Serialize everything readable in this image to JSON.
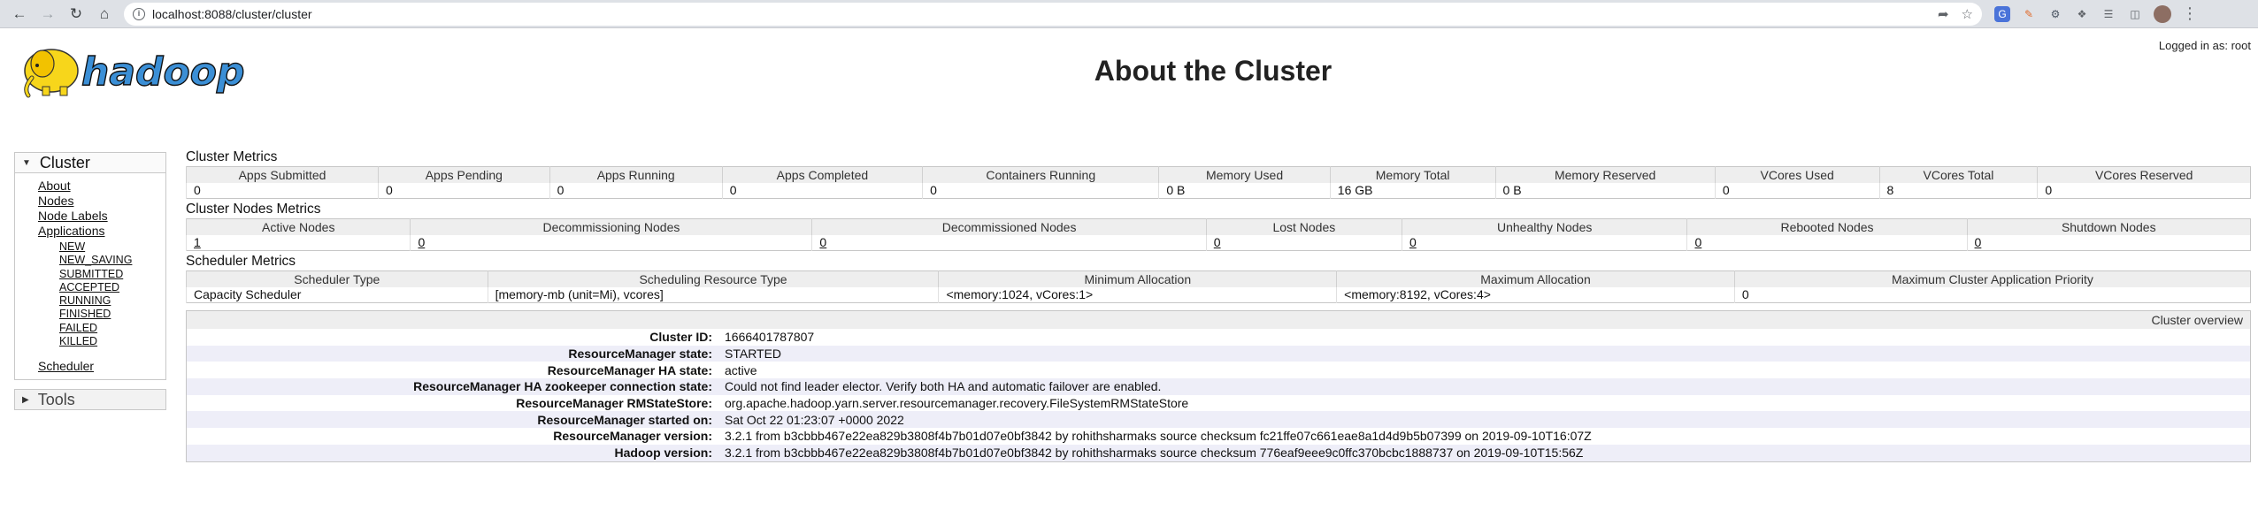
{
  "browser": {
    "url": "localhost:8088/cluster/cluster"
  },
  "header": {
    "logo_text": "hadoop",
    "title": "About the Cluster",
    "logged_in": "Logged in as: root"
  },
  "sidebar": {
    "cluster_label": "Cluster",
    "links": [
      "About",
      "Nodes",
      "Node Labels",
      "Applications"
    ],
    "app_states": [
      "NEW",
      "NEW_SAVING",
      "SUBMITTED",
      "ACCEPTED",
      "RUNNING",
      "FINISHED",
      "FAILED",
      "KILLED"
    ],
    "scheduler_label": "Scheduler",
    "tools_label": "Tools"
  },
  "cluster_metrics": {
    "title": "Cluster Metrics",
    "headers": [
      "Apps Submitted",
      "Apps Pending",
      "Apps Running",
      "Apps Completed",
      "Containers Running",
      "Memory Used",
      "Memory Total",
      "Memory Reserved",
      "VCores Used",
      "VCores Total",
      "VCores Reserved"
    ],
    "values": [
      "0",
      "0",
      "0",
      "0",
      "0",
      "0 B",
      "16 GB",
      "0 B",
      "0",
      "8",
      "0"
    ]
  },
  "nodes_metrics": {
    "title": "Cluster Nodes Metrics",
    "headers": [
      "Active Nodes",
      "Decommissioning Nodes",
      "Decommissioned Nodes",
      "Lost Nodes",
      "Unhealthy Nodes",
      "Rebooted Nodes",
      "Shutdown Nodes"
    ],
    "values": [
      "1",
      "0",
      "0",
      "0",
      "0",
      "0",
      "0"
    ]
  },
  "scheduler_metrics": {
    "title": "Scheduler Metrics",
    "headers": [
      "Scheduler Type",
      "Scheduling Resource Type",
      "Minimum Allocation",
      "Maximum Allocation",
      "Maximum Cluster Application Priority"
    ],
    "values": [
      "Capacity Scheduler",
      "[memory-mb (unit=Mi), vcores]",
      "<memory:1024, vCores:1>",
      "<memory:8192, vCores:4>",
      "0"
    ]
  },
  "overview": {
    "title": "Cluster overview",
    "rows": [
      {
        "label": "Cluster ID:",
        "value": "1666401787807"
      },
      {
        "label": "ResourceManager state:",
        "value": "STARTED"
      },
      {
        "label": "ResourceManager HA state:",
        "value": "active"
      },
      {
        "label": "ResourceManager HA zookeeper connection state:",
        "value": "Could not find leader elector. Verify both HA and automatic failover are enabled."
      },
      {
        "label": "ResourceManager RMStateStore:",
        "value": "org.apache.hadoop.yarn.server.resourcemanager.recovery.FileSystemRMStateStore"
      },
      {
        "label": "ResourceManager started on:",
        "value": "Sat Oct 22 01:23:07 +0000 2022"
      },
      {
        "label": "ResourceManager version:",
        "value": "3.2.1 from b3cbbb467e22ea829b3808f4b7b01d07e0bf3842 by rohithsharmaks source checksum fc21ffe07c661eae8a1d4d9b5b07399 on 2019-09-10T16:07Z"
      },
      {
        "label": "Hadoop version:",
        "value": "3.2.1 from b3cbbb467e22ea829b3808f4b7b01d07e0bf3842 by rohithsharmaks source checksum 776eaf9eee9c0ffc370bcbc1888737 on 2019-09-10T15:56Z"
      }
    ]
  }
}
